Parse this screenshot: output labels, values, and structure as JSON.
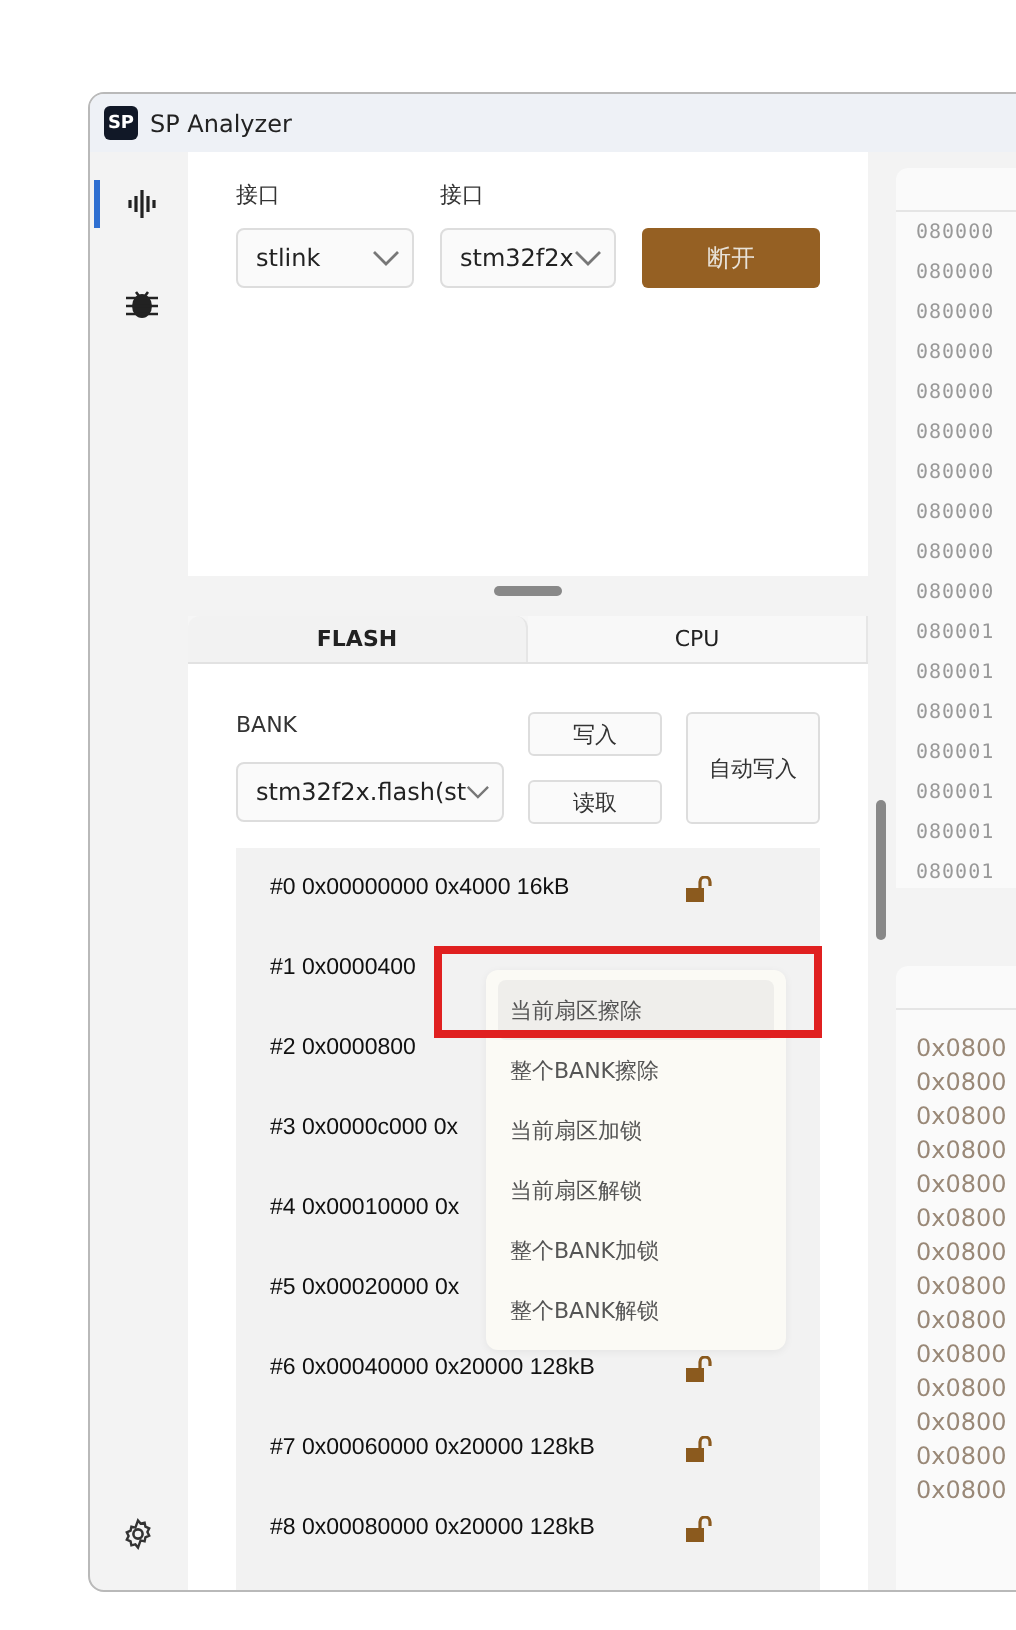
{
  "window": {
    "logo": "SP",
    "title": "SP Analyzer"
  },
  "sidebar": {
    "items": [
      {
        "kind": "wave",
        "selected": true
      },
      {
        "kind": "bug",
        "selected": false
      }
    ]
  },
  "connection": {
    "fields": [
      {
        "label": "接口",
        "value": "stlink"
      },
      {
        "label": "接口",
        "value": "stm32f2x"
      }
    ],
    "button": "断开"
  },
  "tabs": [
    {
      "label": "FLASH",
      "selected": true
    },
    {
      "label": "CPU",
      "selected": false
    }
  ],
  "flash": {
    "bank_label": "BANK",
    "bank_value": "stm32f2x.flash(st",
    "write": "写入",
    "read": "读取",
    "auto_write": "自动写入",
    "sectors": [
      {
        "text": "#0 0x00000000 0x4000 16kB",
        "locked": false
      },
      {
        "text": "#1 0x0000400"
      },
      {
        "text": "#2 0x0000800"
      },
      {
        "text": "#3 0x0000c000 0x"
      },
      {
        "text": "#4 0x00010000 0x"
      },
      {
        "text": "#5 0x00020000 0x"
      },
      {
        "text": "#6 0x00040000 0x20000 128kB",
        "locked": false
      },
      {
        "text": "#7 0x00060000 0x20000 128kB",
        "locked": false
      },
      {
        "text": "#8 0x00080000 0x20000 128kB",
        "locked": false
      }
    ]
  },
  "context_menu": {
    "items": [
      {
        "label": "当前扇区擦除",
        "selected": true
      },
      {
        "label": "整个BANK擦除",
        "selected": false
      },
      {
        "label": "当前扇区加锁",
        "selected": false
      },
      {
        "label": "当前扇区解锁",
        "selected": false
      },
      {
        "label": "整个BANK加锁",
        "selected": false
      },
      {
        "label": "整个BANK解锁",
        "selected": false
      }
    ]
  },
  "memory_top": {
    "rows": [
      "080000",
      "080000",
      "080000",
      "080000",
      "080000",
      "080000",
      "080000",
      "080000",
      "080000",
      "080000",
      "080001",
      "080001",
      "080001",
      "080001",
      "080001",
      "080001",
      "080001"
    ]
  },
  "memory_bottom": {
    "rows": [
      "0x0800",
      "0x0800",
      "0x0800",
      "0x0800",
      "0x0800",
      "0x0800",
      "0x0800",
      "0x0800",
      "0x0800",
      "0x0800",
      "0x0800",
      "0x0800",
      "0x0800",
      "0x0800"
    ]
  }
}
